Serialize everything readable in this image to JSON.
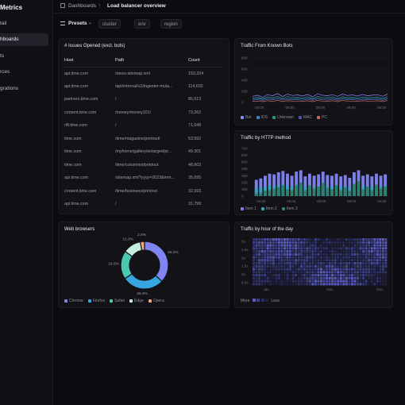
{
  "app": {
    "title": "Metrics"
  },
  "sidebar": {
    "items": [
      {
        "label": "tail",
        "active": false
      },
      {
        "label": "hboards",
        "active": true
      },
      {
        "label": "ts",
        "active": false
      },
      {
        "label": "rces",
        "active": false
      },
      {
        "label": "grations",
        "active": false
      }
    ]
  },
  "breadcrumb": {
    "root": "Dashboards",
    "current": "Load balancer overview"
  },
  "filters": {
    "presets": "Presets",
    "chips": [
      "cluster",
      "env",
      "region"
    ]
  },
  "issues_table": {
    "title": "# Issues Opened (excl. bots)",
    "columns": [
      "Host",
      "Path",
      "Count"
    ],
    "rows": [
      [
        "api.time.com",
        "/news-sitemap.xml",
        "153,324"
      ],
      [
        "api.time.com",
        "/api/internal/v2/ingester-mula...",
        "114,692"
      ],
      [
        "partners.time.com",
        "/",
        "86,513"
      ],
      [
        "content.time.com",
        "/money/money101/",
        "73,262"
      ],
      [
        "rift.time.com",
        "/",
        "71,048"
      ],
      [
        "time.com",
        "/time/magazine/printout/",
        "53,592"
      ],
      [
        "time.com",
        "/myhome/gallery/enlarged/pr...",
        "49,301"
      ],
      [
        "time.com",
        "/time/columnist/printout",
        "48,602"
      ],
      [
        "api.time.com",
        "/sitemap.xml?yyyy=2023&mm...",
        "35,695"
      ],
      [
        "content.time.com",
        "/time/business/printout",
        "32,593"
      ],
      [
        "api.time.com",
        "/",
        "31,799"
      ]
    ]
  },
  "known_bots": {
    "title": "Traffic From Known Bots",
    "legend": [
      "Bot",
      "IOS",
      "Unknown",
      "MAC",
      "PC"
    ],
    "colors": [
      "#8a8ef0",
      "#3b82c4",
      "#2f8f8a",
      "#4b55b0",
      "#c06a5a"
    ]
  },
  "http_method": {
    "title": "Traffic by HTTP method",
    "legend": [
      "Item 1",
      "Item 2",
      "Item 3"
    ],
    "colors": [
      "#7c7fe8",
      "#3aa0c0",
      "#2e7f6c"
    ]
  },
  "browsers": {
    "title": "Web browsers",
    "colors": [
      "#7f84f2",
      "#35a6e0",
      "#4bc9b0",
      "#c4eedc",
      "#f0a48a"
    ]
  },
  "hourly": {
    "title": "Traffic by hour of the day",
    "legend": {
      "more": "More",
      "less": "Less"
    }
  },
  "chart_data": [
    {
      "type": "line",
      "title": "Traffic From Known Bots",
      "ylim": [
        0,
        800
      ],
      "y_ticks": [
        "800",
        "600",
        "400",
        "200",
        "0"
      ],
      "x_ticks": [
        "09:00",
        "09:00",
        "09:00",
        "09:00",
        "09:00"
      ],
      "series": [
        {
          "name": "Bot",
          "values": [
            110,
            130,
            95,
            140,
            120,
            160,
            105,
            150,
            125,
            135,
            115,
            145,
            100,
            155,
            130,
            120,
            140,
            110,
            150,
            125,
            135,
            115,
            145,
            120,
            130,
            140,
            110,
            150
          ]
        },
        {
          "name": "IOS",
          "values": [
            80,
            95,
            70,
            100,
            85,
            110,
            75,
            105,
            90,
            95,
            80,
            100,
            70,
            110,
            90,
            85,
            100,
            75,
            105,
            85,
            95,
            80,
            100,
            85,
            90,
            100,
            75,
            105
          ]
        },
        {
          "name": "Unknown",
          "values": [
            60,
            70,
            55,
            75,
            65,
            80,
            60,
            75,
            65,
            70,
            60,
            75,
            55,
            80,
            65,
            60,
            75,
            55,
            80,
            65,
            70,
            60,
            75,
            65,
            70,
            75,
            55,
            80
          ]
        },
        {
          "name": "MAC",
          "values": [
            40,
            50,
            35,
            55,
            45,
            60,
            40,
            55,
            45,
            50,
            40,
            55,
            35,
            60,
            45,
            40,
            55,
            35,
            60,
            45,
            50,
            40,
            55,
            45,
            50,
            55,
            35,
            60
          ]
        },
        {
          "name": "PC",
          "values": [
            20,
            25,
            15,
            30,
            20,
            35,
            20,
            30,
            25,
            25,
            20,
            30,
            15,
            35,
            25,
            20,
            30,
            15,
            35,
            25,
            25,
            20,
            30,
            25,
            25,
            30,
            15,
            35
          ]
        }
      ]
    },
    {
      "type": "bar",
      "title": "Traffic by HTTP method",
      "ylim": [
        0,
        700
      ],
      "y_ticks": [
        "700",
        "600",
        "500",
        "400",
        "300",
        "200",
        "100",
        "0"
      ],
      "x_ticks": [
        "09:00",
        "09:00",
        "09:00",
        "09:00",
        "09:00"
      ],
      "series": [
        {
          "name": "Item 1",
          "values": [
            240,
            260,
            300,
            330,
            320,
            350,
            370,
            330,
            300,
            360,
            380,
            290,
            330,
            300,
            320,
            360,
            310,
            300,
            330,
            290,
            310,
            270,
            350,
            380,
            300,
            320,
            290,
            330,
            300,
            320
          ]
        },
        {
          "name": "Item 2",
          "values": [
            120,
            130,
            140,
            160,
            150,
            160,
            180,
            150,
            140,
            170,
            180,
            140,
            160,
            140,
            150,
            170,
            150,
            140,
            160,
            140,
            150,
            130,
            170,
            180,
            140,
            150,
            140,
            160,
            140,
            150
          ]
        },
        {
          "name": "Item 3",
          "values": [
            40,
            50,
            80,
            90,
            110,
            130,
            160,
            100,
            90,
            160,
            200,
            90,
            160,
            110,
            140,
            200,
            120,
            100,
            160,
            90,
            130,
            80,
            180,
            220,
            100,
            140,
            90,
            170,
            110,
            140
          ]
        }
      ]
    },
    {
      "type": "pie",
      "title": "Web browsers",
      "slices": [
        {
          "name": "Chrome",
          "value": 36.2,
          "label": "36.2%"
        },
        {
          "name": "Firefox",
          "value": 28.0,
          "label": "28.0%"
        },
        {
          "name": "Safari",
          "value": 19.0,
          "label": "19.0%"
        },
        {
          "name": "Edge",
          "value": 12.0,
          "label": "12.0%"
        },
        {
          "name": "Opera",
          "value": 2.8,
          "label": "2.8%"
        }
      ]
    },
    {
      "type": "heatmap",
      "title": "Traffic by hour of the day",
      "y_ticks": [
        "3s",
        "2.5s",
        "2s",
        "1.5s",
        "1s",
        "0.5s"
      ],
      "x_ticks": [
        "Jan",
        "Nov",
        "Dec"
      ],
      "rows": 16,
      "cols": 48
    }
  ]
}
